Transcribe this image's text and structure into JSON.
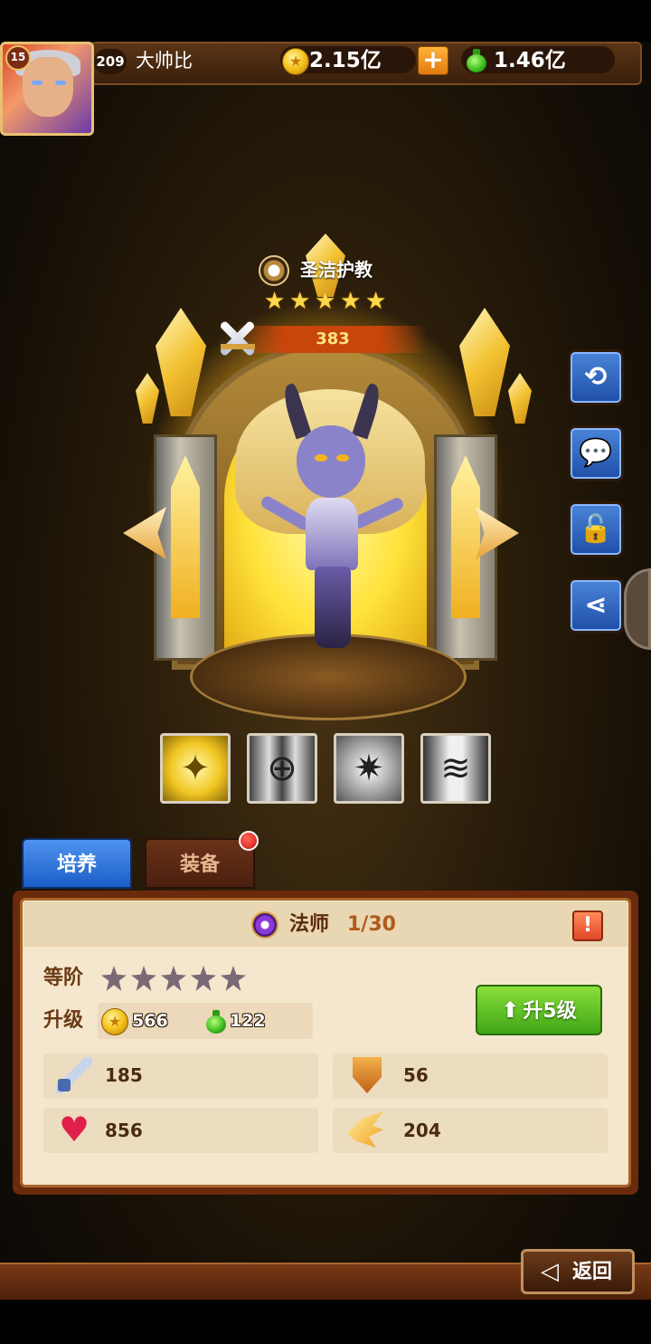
{
  "player": {
    "avatar_level": "15",
    "level": "209",
    "name": "大帅比",
    "gold": "2.15亿",
    "exp": "1.46亿"
  },
  "hero": {
    "faction_icon": "holy-faction-icon",
    "name": "圣洁护教",
    "stars": 5,
    "power": "383",
    "skills": [
      "holy-light-skill-icon",
      "crosshair-skill-icon",
      "shatter-skill-icon",
      "tornado-skill-icon"
    ]
  },
  "side_buttons": [
    "refresh-icon",
    "chat-icon",
    "unlock-icon",
    "share-icon"
  ],
  "tabs": {
    "train": "培养",
    "equip": "装备"
  },
  "panel": {
    "class_name": "法师",
    "class_level": "1/30",
    "info_label": "!",
    "grade_label": "等阶",
    "grade_stars": 5,
    "upgrade_label": "升级",
    "cost_gold": "566",
    "cost_exp": "122",
    "upgrade_button": "升5级"
  },
  "stats": {
    "attack": "185",
    "defense": "56",
    "hp": "856",
    "speed": "204"
  },
  "back_label": "返回",
  "colors": {
    "primary_blue": "#1c5ec8",
    "upgrade_green": "#3fa516",
    "panel_bg": "#f4e7cd",
    "gold": "#f4c21a"
  }
}
